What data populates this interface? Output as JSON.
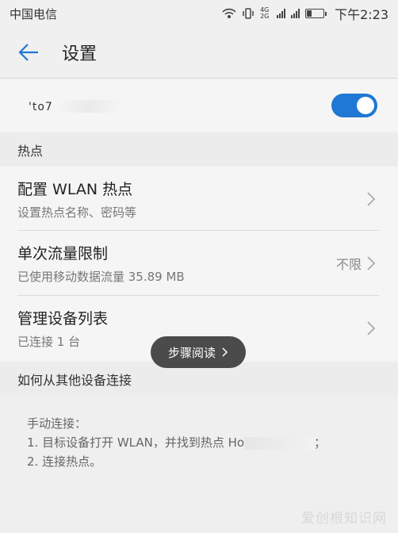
{
  "status_bar": {
    "carrier": "中国电信",
    "indicators": "4G 2G",
    "time": "下午2:23"
  },
  "toolbar": {
    "title": "设置"
  },
  "hotspot": {
    "name_visible": "'to7",
    "toggle_on": true,
    "accent_color": "#1e78d4"
  },
  "sections": {
    "hotspot_header": "热点",
    "connect_header": "如何从其他设备连接"
  },
  "rows": [
    {
      "title": "配置 WLAN 热点",
      "subtitle": "设置热点名称、密码等",
      "value": ""
    },
    {
      "title": "单次流量限制",
      "subtitle": "已使用移动数据流量 35.89 MB",
      "value": "不限"
    },
    {
      "title": "管理设备列表",
      "subtitle": "已连接 1 台",
      "value": ""
    }
  ],
  "toast": {
    "label": "步骤阅读"
  },
  "instructions": {
    "heading": "手动连接：",
    "step1_prefix": "1. 目标设备打开 WLAN，并找到热点 Ho",
    "step1_suffix": "；",
    "step2": "2. 连接热点。"
  },
  "watermark": "爱创根知识网"
}
